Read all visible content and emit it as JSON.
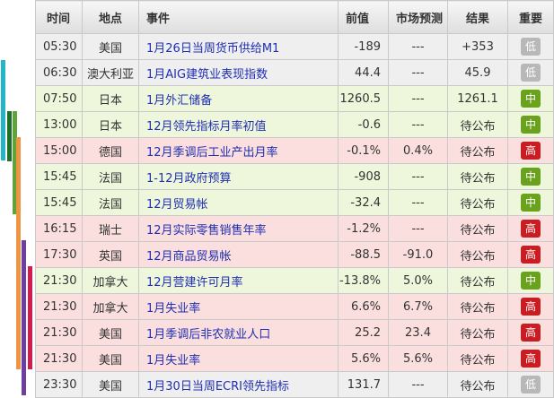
{
  "headers": {
    "time": "时间",
    "location": "地点",
    "event": "事件",
    "prev": "前值",
    "forecast": "市场预测",
    "result": "结果",
    "importance": "重要"
  },
  "colors": {
    "low": "#b8b8b8",
    "mid": "#6aa21d",
    "high": "#c81d22",
    "link": "#1f2fb3",
    "bar_teal": "#23b5c8",
    "bar_green": "#5ea43a",
    "bar_dark": "#1d6f2b",
    "bar_orange": "#ef9440",
    "bar_purple": "#6d3fa3",
    "bar_crimson": "#d21c4d"
  },
  "rows": [
    {
      "time": "05:30",
      "location": "美国",
      "event": "1月26日当周货币供给M1",
      "prev": "-189",
      "forecast": "---",
      "result": "+353",
      "importance": "低",
      "level": "low"
    },
    {
      "time": "06:30",
      "location": "澳大利亚",
      "event": "1月AIG建筑业表现指数",
      "prev": "44.4",
      "forecast": "---",
      "result": "45.9",
      "importance": "低",
      "level": "low"
    },
    {
      "time": "07:50",
      "location": "日本",
      "event": "1月外汇储备",
      "prev": "1260.5",
      "forecast": "---",
      "result": "1261.1",
      "importance": "中",
      "level": "mid"
    },
    {
      "time": "13:00",
      "location": "日本",
      "event": "12月领先指标月率初值",
      "prev": "-0.6",
      "forecast": "---",
      "result": "待公布",
      "importance": "中",
      "level": "mid"
    },
    {
      "time": "15:00",
      "location": "德国",
      "event": "12月季调后工业产出月率",
      "prev": "-0.1%",
      "forecast": "0.4%",
      "result": "待公布",
      "importance": "高",
      "level": "high"
    },
    {
      "time": "15:45",
      "location": "法国",
      "event": "1-12月政府预算",
      "prev": "-908",
      "forecast": "---",
      "result": "待公布",
      "importance": "中",
      "level": "mid"
    },
    {
      "time": "15:45",
      "location": "法国",
      "event": "12月贸易帐",
      "prev": "-32.4",
      "forecast": "---",
      "result": "待公布",
      "importance": "中",
      "level": "mid"
    },
    {
      "time": "16:15",
      "location": "瑞士",
      "event": "12月实际零售销售年率",
      "prev": "-1.2%",
      "forecast": "---",
      "result": "待公布",
      "importance": "高",
      "level": "high"
    },
    {
      "time": "17:30",
      "location": "英国",
      "event": "12月商品贸易帐",
      "prev": "-88.5",
      "forecast": "-91.0",
      "result": "待公布",
      "importance": "高",
      "level": "high"
    },
    {
      "time": "21:30",
      "location": "加拿大",
      "event": "12月营建许可月率",
      "prev": "-13.8%",
      "forecast": "5.0%",
      "result": "待公布",
      "importance": "中",
      "level": "mid"
    },
    {
      "time": "21:30",
      "location": "加拿大",
      "event": "1月失业率",
      "prev": "6.6%",
      "forecast": "6.7%",
      "result": "待公布",
      "importance": "高",
      "level": "high"
    },
    {
      "time": "21:30",
      "location": "美国",
      "event": "1月季调后非农就业人口",
      "prev": "25.2",
      "forecast": "23.4",
      "result": "待公布",
      "importance": "高",
      "level": "high"
    },
    {
      "time": "21:30",
      "location": "美国",
      "event": "1月失业率",
      "prev": "5.6%",
      "forecast": "5.6%",
      "result": "待公布",
      "importance": "高",
      "level": "high"
    },
    {
      "time": "23:30",
      "location": "美国",
      "event": "1月30日当周ECRI领先指标",
      "prev": "131.7",
      "forecast": "---",
      "result": "待公布",
      "importance": "低",
      "level": "low"
    }
  ]
}
